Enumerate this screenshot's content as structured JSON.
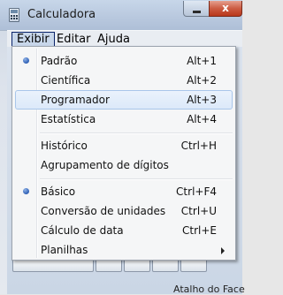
{
  "window": {
    "title": "Calculadora",
    "close_glyph": "x"
  },
  "menubar": {
    "items": [
      {
        "label": "Exibir"
      },
      {
        "label": "Editar"
      },
      {
        "label": "Ajuda"
      }
    ]
  },
  "view_menu": {
    "items": [
      {
        "label": "Padrão",
        "shortcut": "Alt+1",
        "checked": true
      },
      {
        "label": "Científica",
        "shortcut": "Alt+2"
      },
      {
        "label": "Programador",
        "shortcut": "Alt+3",
        "highlighted": true
      },
      {
        "label": "Estatística",
        "shortcut": "Alt+4"
      },
      {
        "label": "Histórico",
        "shortcut": "Ctrl+H"
      },
      {
        "label": "Agrupamento de dígitos",
        "shortcut": ""
      },
      {
        "label": "Básico",
        "shortcut": "Ctrl+F4",
        "checked": true
      },
      {
        "label": "Conversão de unidades",
        "shortcut": "Ctrl+U"
      },
      {
        "label": "Cálculo de data",
        "shortcut": "Ctrl+E"
      },
      {
        "label": "Planilhas",
        "shortcut": "",
        "submenu": true
      }
    ]
  },
  "footer_text": "Atalho do Face",
  "icons": {
    "radio": "radio-selected-icon",
    "submenu": "submenu-arrow-icon"
  }
}
